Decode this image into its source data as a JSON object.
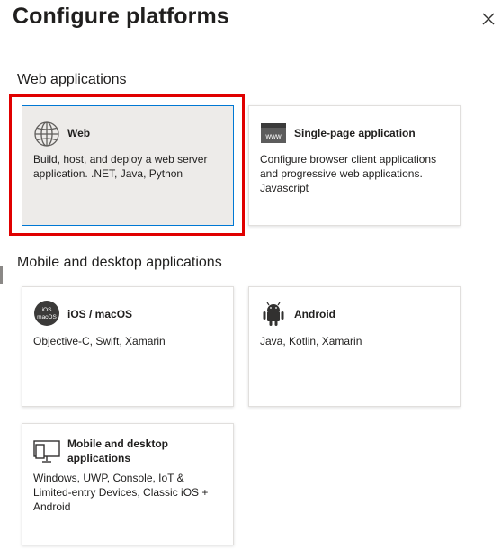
{
  "dialog": {
    "title": "Configure platforms",
    "close_label": "×"
  },
  "sections": {
    "web": {
      "title": "Web applications"
    },
    "mobile": {
      "title": "Mobile and desktop applications"
    }
  },
  "cards": {
    "web": {
      "title": "Web",
      "description": "Build, host, and deploy a web server application. .NET, Java, Python",
      "selected": true,
      "icon": "globe-icon"
    },
    "spa": {
      "title": "Single-page application",
      "description": "Configure browser client applications and progressive web applications. Javascript",
      "icon": "www-browser-icon",
      "icon_text": "www"
    },
    "ios": {
      "title": "iOS / macOS",
      "description": "Objective-C, Swift, Xamarin",
      "icon": "ios-macos-icon",
      "icon_text_1": "iOS",
      "icon_text_2": "macOS"
    },
    "android": {
      "title": "Android",
      "description": "Java, Kotlin, Xamarin",
      "icon": "android-icon"
    },
    "desktop": {
      "title": "Mobile and desktop applications",
      "description": "Windows, UWP, Console, IoT & Limited-entry Devices, Classic iOS + Android",
      "icon": "desktop-monitor-icon"
    }
  },
  "colors": {
    "selection_highlight": "#e00000",
    "selected_border": "#0078d4",
    "selected_background": "#edebe9"
  }
}
